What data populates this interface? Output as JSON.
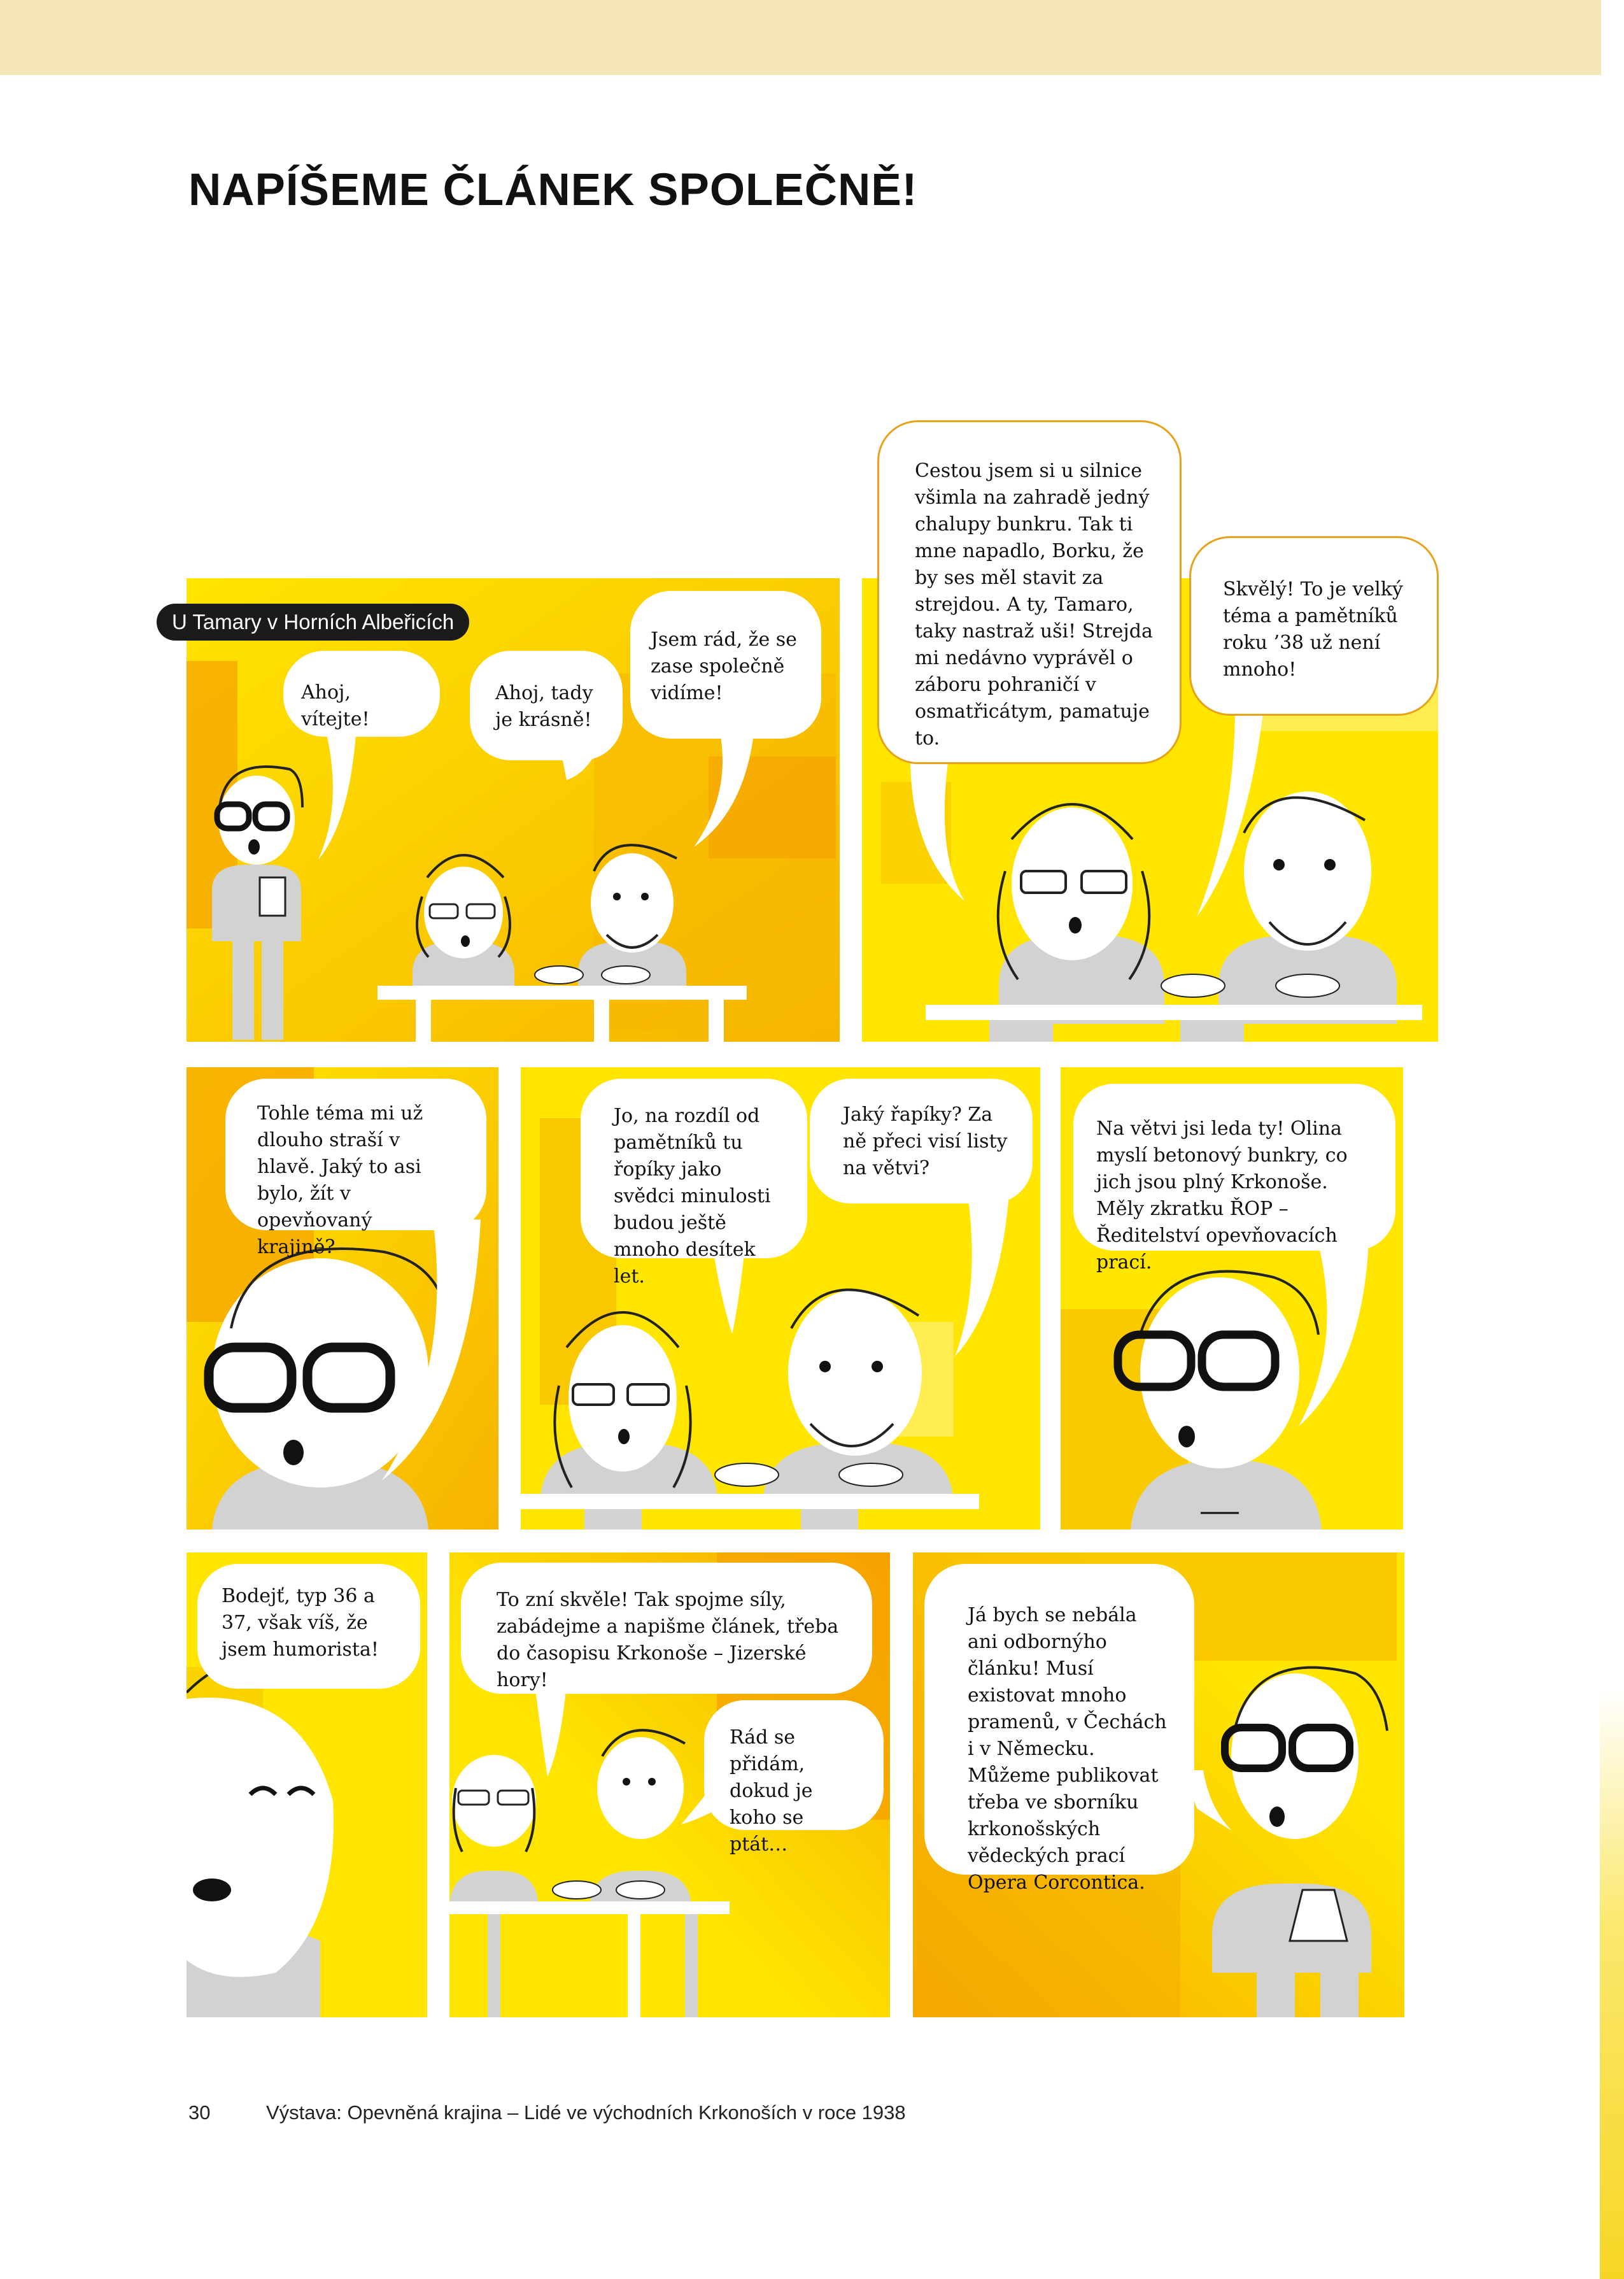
{
  "header": {
    "title": "NAPÍŠEME ČLÁNEK SPOLEČNĚ!"
  },
  "comic": {
    "caption": "U Tamary v Horních Albeřicích",
    "bubbles": {
      "p1_b1": "Ahoj, vítejte!",
      "p1_b2": "Ahoj, tady je krásně!",
      "p1_b3": "Jsem rád, že se zase společně vidíme!",
      "p2_b1": "Cestou jsem si u silnice všimla na zahradě jedný chalupy bunkru. Tak ti mne napadlo, Borku, že by ses měl stavit za strejdou. A ty, Tamaro, taky nastraž uši! Strejda mi nedávno vyprávěl o záboru pohraničí v osmatřicátym, pamatuje to.",
      "p2_b2": "Skvělý! To je velký téma a pamětníků roku ’38 už není mnoho!",
      "p3_b1": "Tohle téma mi už dlouho straší v hlavě. Jaký to asi bylo, žít v opevňovaný krajině?",
      "p4_b1": "Jo, na rozdíl od pamětníků tu řopíky jako svědci minulosti budou ještě mnoho desítek let.",
      "p4_b2": "Jaký řapíky? Za ně přeci visí listy na větvi?",
      "p5_b1": "Na větvi jsi leda ty! Olina myslí betonový bunkry, co jich jsou plný Krkonoše. Měly zkratku ŘOP – Ředitelství opevňovacích prací.",
      "p6_b1": "Bodejť, typ 36 a 37, však víš, že jsem humorista!",
      "p7_b1": "To zní skvěle! Tak spojme síly, zabádejme a napišme článek, třeba do časopisu Krkonoše – Jizerské hory!",
      "p7_b2": "Rád se přidám, dokud je koho se ptát…",
      "p8_b1": "Já bych se nebála ani odbornýho článku! Musí existovat mnoho pramenů, v Čechách i v Německu. Můžeme publikovat třeba ve sborníku krkonošských vědeckých prací Opera Corcontica."
    }
  },
  "footer": {
    "page_number": "30",
    "text": "Výstava: Opevněná krajina – Lidé ve východních Krkonoších v roce 1938"
  },
  "colors": {
    "yellow": "#ffe500",
    "orange": "#f5a800",
    "grey": "#d2d2d2",
    "band": "#f6e7b8"
  }
}
